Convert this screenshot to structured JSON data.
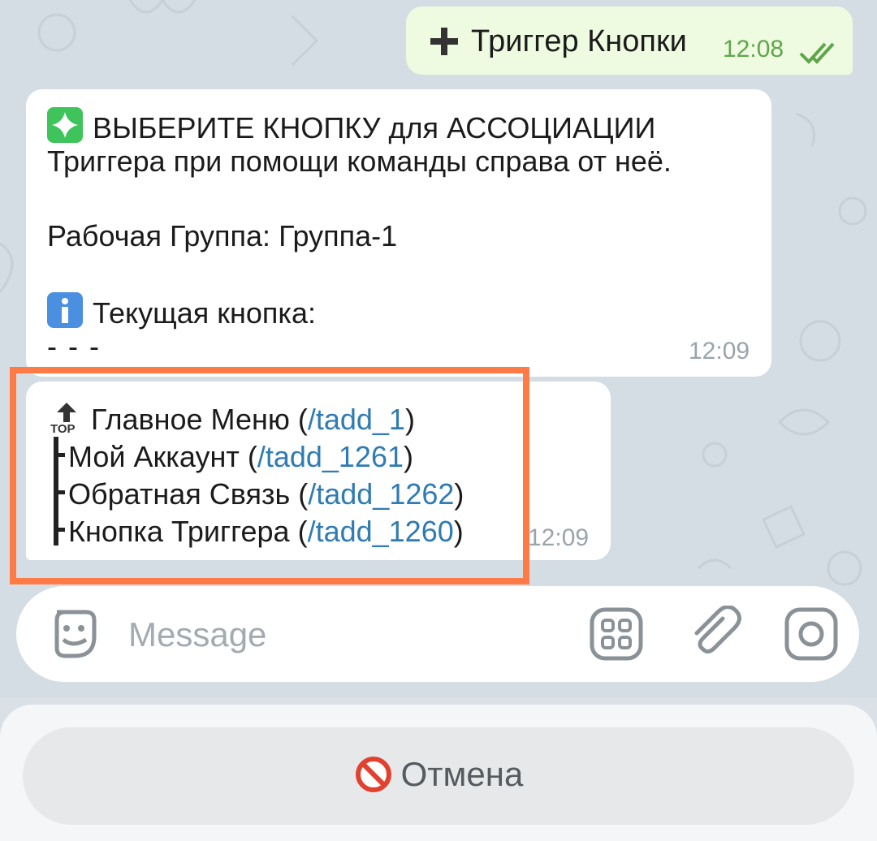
{
  "outgoing": {
    "text": "Триггер Кнопки",
    "time": "12:08"
  },
  "message1": {
    "line1": "ВЫБЕРИТЕ КНОПКУ для АССОЦИАЦИИ",
    "line2": "Триггера при помощи команды справа от неё.",
    "group": "Рабочая Группа: Группа-1",
    "current": "Текущая кнопка:",
    "value": "- - -",
    "time": "12:09"
  },
  "message2": {
    "time": "12:09",
    "items": [
      {
        "label": "Главное Меню (",
        "cmd": "/tadd_1",
        "tail": ")"
      },
      {
        "label": "Мой Аккаунт (",
        "cmd": "/tadd_1261",
        "tail": ")"
      },
      {
        "label": "Обратная Связь (",
        "cmd": "/tadd_1262",
        "tail": ")"
      },
      {
        "label": "Кнопка Триггера (",
        "cmd": "/tadd_1260",
        "tail": ")"
      }
    ],
    "top_badge": "TOP"
  },
  "input": {
    "placeholder": "Message"
  },
  "cancel": {
    "label": "Отмена"
  },
  "colors": {
    "outgoing_bubble": "#eefbe0",
    "link": "#2f7bb3",
    "highlight": "#ff7a45",
    "sparkle_box": "#3ec45a",
    "info_box": "#4a8fe0"
  },
  "icons": [
    "plus-icon",
    "double-check-icon",
    "sparkle-icon",
    "info-icon",
    "top-arrow-icon",
    "sticker-icon",
    "bot-menu-icon",
    "paperclip-icon",
    "camera-icon",
    "prohibited-icon"
  ]
}
